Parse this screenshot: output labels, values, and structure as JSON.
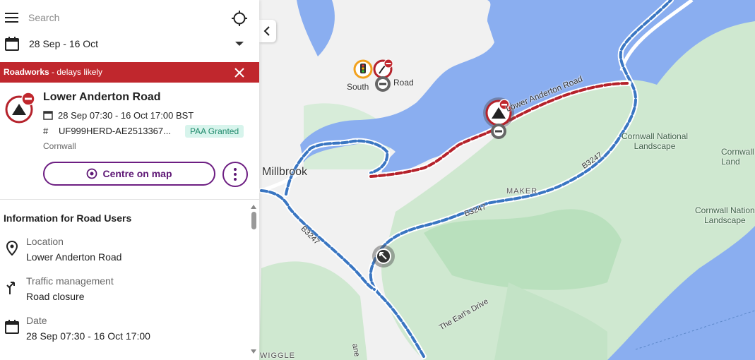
{
  "search": {
    "placeholder": "Search"
  },
  "dates": {
    "range": "28 Sep - 16 Oct"
  },
  "banner": {
    "title": "Roadworks",
    "subtitle": " - delays likely"
  },
  "roadwork": {
    "title": "Lower Anderton Road",
    "when": "28 Sep 07:30 - 16 Oct 17:00 BST",
    "reference": "UF999HERD-AE2513367...",
    "permit_status": "PAA Granted",
    "region": "Cornwall",
    "centre_button": "Centre on map"
  },
  "info": {
    "title": "Information for Road Users",
    "items": [
      {
        "label": "Location",
        "value": "Lower Anderton Road",
        "icon": "location-pin-icon"
      },
      {
        "label": "Traffic management",
        "value": "Road closure",
        "icon": "diversion-arrow-icon"
      },
      {
        "label": "Date",
        "value": "28 Sep 07:30 - 16 Oct 17:00",
        "icon": "calendar-icon"
      }
    ]
  },
  "map": {
    "labels": {
      "millbrook": "Millbrook",
      "southdown_a": "South",
      "southdown_b": "Road",
      "lower_anderton": "Lower Anderton Road",
      "cornwall_nl_1": "Cornwall National",
      "cornwall_nl_1b": "Landscape",
      "cornwall_nl_2": "Cornwall",
      "cornwall_nl_2b": "Land",
      "cornwall_nl_3": "Cornwall Nation",
      "cornwall_nl_3b": "Landscape",
      "b3247_a": "B3247",
      "b3247_b": "B3247",
      "b3247_c": "B3247",
      "maker": "MAKER",
      "earls_drive": "The Earl's Drive",
      "wiggle": "WIGGLE",
      "lane": "ane"
    }
  },
  "colors": {
    "brand_purple": "#6d1e82",
    "banner_red": "#c0272d",
    "water": "#8aaef0",
    "land": "#f2f2f2",
    "green": "#cfe9d2",
    "diversion_blue": "#3a76c2",
    "closure_red": "#b5222b",
    "badge_bg": "#d7f4ec"
  }
}
